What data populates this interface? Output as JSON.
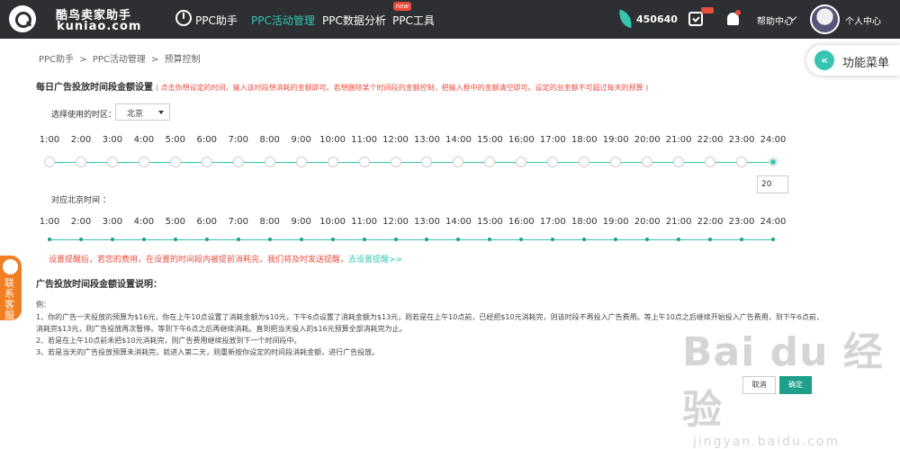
{
  "topbar": {
    "logo_cn": "酷鸟卖家助手",
    "logo_en": "kuniao.com",
    "nav": [
      {
        "label": "PPC助手",
        "active": false
      },
      {
        "label": "PPC活动管理",
        "active": true
      },
      {
        "label": "PPC数据分析",
        "active": false
      },
      {
        "label": "PPC工具",
        "active": false,
        "badge": "new"
      }
    ],
    "points": "450640",
    "calendar_badge": "new",
    "help_label": "帮助中心",
    "user_label": "个人中心",
    "accent_color": "#35c5b1"
  },
  "func_menu": {
    "label": "功能菜单",
    "icon": "double-chevron-left-icon"
  },
  "support_tab": {
    "label": "联系客服"
  },
  "breadcrumb": [
    "PPC助手",
    ">",
    "PPC活动管理",
    ">",
    "预算控制"
  ],
  "section": {
    "title": "每日广告投放时间段金额设置",
    "tip": "( 点击你想设定的时间，输入该时段想消耗的金额即可。若想删除某个时间段的金额控制，把输入框中的金额清空即可。设定的总金额不可超过每天的预算 )"
  },
  "timezone": {
    "label": "选择使用的时区：",
    "value": "北京"
  },
  "hours": [
    "1:00",
    "2:00",
    "3:00",
    "4:00",
    "5:00",
    "6:00",
    "7:00",
    "8:00",
    "9:00",
    "10:00",
    "11:00",
    "12:00",
    "13:00",
    "14:00",
    "15:00",
    "16:00",
    "17:00",
    "18:00",
    "19:00",
    "20:00",
    "21:00",
    "22:00",
    "23:00",
    "24:00"
  ],
  "amount_value": "20",
  "beijing_label": "对应北京时间 ：",
  "remind": {
    "text": "设置提醒后，若您的费用，在设置的时间段内被提前消耗完，我们将及时发送提醒，",
    "link": "去设置提醒>>"
  },
  "desc": {
    "title": "广告投放时间段金额设置说明：",
    "lines": [
      "例：",
      "1、你的广告一天投放的预算为$16元，你在上午10点设置了消耗金额为$10元，下午6点设置了消耗金额为$13元，则若是在上午10点前，已经把$10元消耗完，则该时段不再投入广告费用。等上午10点之后继续开始投入广告费用，到下午6点前，消耗完$13元，则广告投放再次暂停。等到下午6点之后再继续消耗。直到把当天投入的$16元预算全部消耗完为止。",
      "2、若是在上午10点前未把$10元消耗完，则广告费用继续投放到下一个时间段中。",
      "3、若是当天的广告投放预算未消耗完，就进入第二天，则重新按你设定的时间段消耗金额，进行广告投放。"
    ]
  },
  "buttons": {
    "cancel": "取消",
    "ok": "确定"
  },
  "watermark": {
    "logo": "Bai du 经验",
    "url": "jingyan.baidu.com"
  }
}
